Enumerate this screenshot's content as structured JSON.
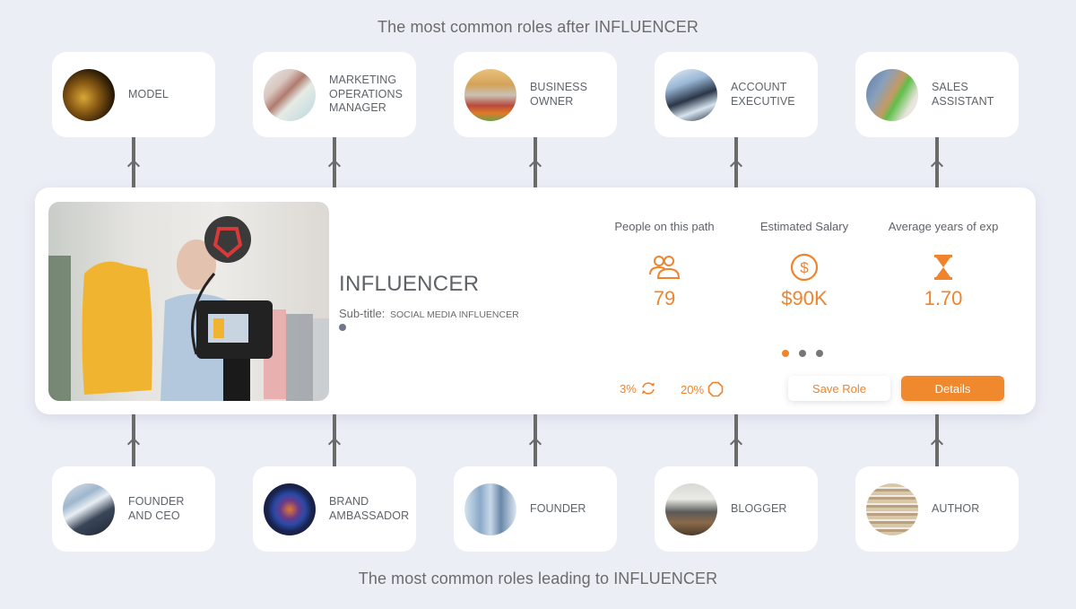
{
  "titles": {
    "after": "The most common roles after INFLUENCER",
    "leading": "The most common roles leading to INFLUENCER"
  },
  "next_roles": [
    {
      "label": "MODEL",
      "image": "model-photo"
    },
    {
      "label": "MARKETING\nOPERATIONS\nMANAGER",
      "image": "marketing-photo"
    },
    {
      "label": "BUSINESS\nOWNER",
      "image": "business-owner-photo"
    },
    {
      "label": "ACCOUNT\nEXECUTIVE",
      "image": "account-executive-photo"
    },
    {
      "label": "SALES\nASSISTANT",
      "image": "sales-assistant-photo"
    }
  ],
  "previous_roles": [
    {
      "label": "FOUNDER\nAND CEO",
      "image": "founder-ceo-photo"
    },
    {
      "label": "BRAND\nAMBASSADOR",
      "image": "brand-ambassador-photo"
    },
    {
      "label": "FOUNDER",
      "image": "founder-photo"
    },
    {
      "label": "BLOGGER",
      "image": "blogger-photo"
    },
    {
      "label": "AUTHOR",
      "image": "author-photo"
    }
  ],
  "current_role": {
    "title": "INFLUENCER",
    "subtitle_label": "Sub-title:",
    "subtitle_value": "SOCIAL MEDIA INFLUENCER",
    "image": "influencer-camera-photo",
    "stats": {
      "people": {
        "label": "People on this path",
        "value": "79",
        "icon": "people-icon"
      },
      "salary": {
        "label": "Estimated Salary",
        "value": "$90K",
        "icon": "dollar-circle-icon"
      },
      "experience": {
        "label": "Average years of exp",
        "value": "1.70",
        "icon": "hourglass-icon"
      }
    },
    "pager": {
      "count": 3,
      "active": 1
    },
    "metrics": [
      {
        "value": "3%",
        "icon": "rotate-icon"
      },
      {
        "value": "20%",
        "icon": "circle-icon"
      }
    ],
    "buttons": {
      "save": "Save Role",
      "details": "Details"
    }
  },
  "colors": {
    "accent": "#f0842c",
    "background": "#eceef6",
    "text": "#5f6368",
    "connector": "#6a6a6a"
  }
}
